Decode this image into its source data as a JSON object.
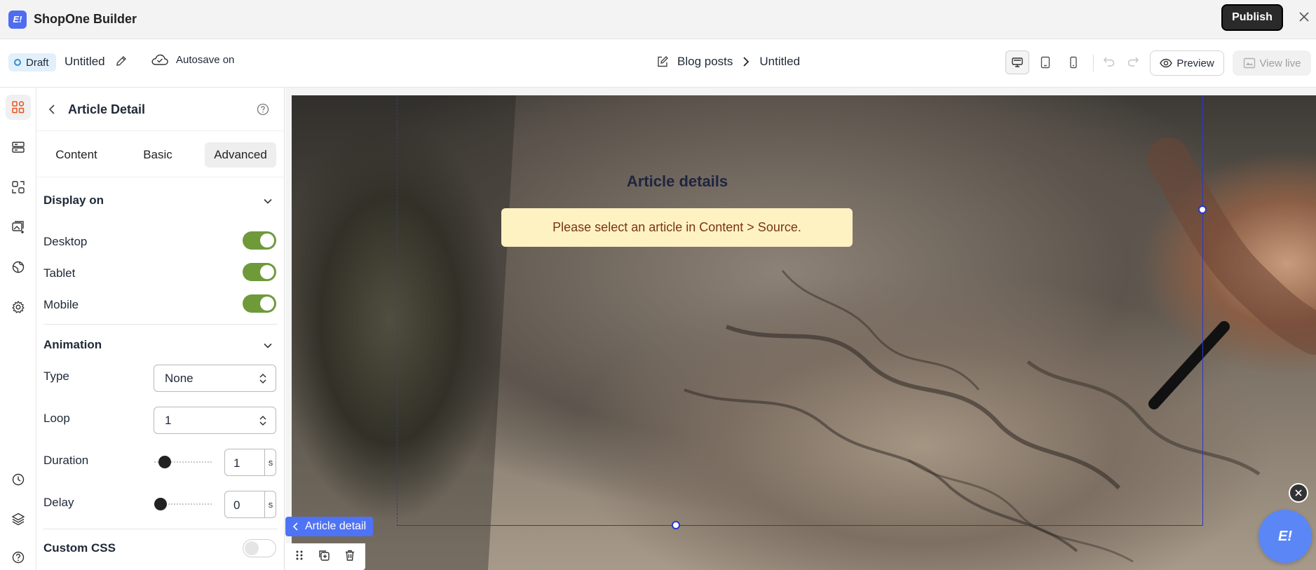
{
  "app": {
    "title": "ShopOne Builder",
    "logo_text": "E!"
  },
  "topbar": {
    "publish_label": "Publish"
  },
  "subbar": {
    "status": "Draft",
    "doc_name": "Untitled",
    "autosave": "Autosave on",
    "breadcrumb": [
      "Blog posts",
      "Untitled"
    ],
    "preview_label": "Preview",
    "view_live_label": "View live"
  },
  "panel": {
    "title": "Article Detail",
    "tabs": [
      {
        "label": "Content"
      },
      {
        "label": "Basic"
      },
      {
        "label": "Advanced"
      }
    ],
    "active_tab": "Advanced",
    "display_on": {
      "title": "Display on",
      "desktop": {
        "label": "Desktop",
        "on": true
      },
      "tablet": {
        "label": "Tablet",
        "on": true
      },
      "mobile": {
        "label": "Mobile",
        "on": true
      }
    },
    "animation": {
      "title": "Animation",
      "type_label": "Type",
      "type_value": "None",
      "loop_label": "Loop",
      "loop_value": "1",
      "duration_label": "Duration",
      "duration_value": "1",
      "duration_unit": "s",
      "delay_label": "Delay",
      "delay_value": "0",
      "delay_unit": "s"
    },
    "custom_css": {
      "label": "Custom CSS",
      "on": false
    }
  },
  "canvas": {
    "heading": "Article details",
    "notice": "Please select an article in Content > Source.",
    "element_label": "Article detail"
  },
  "colors": {
    "toggle_on": "#6e9a3a",
    "selection": "#2a37c9",
    "chip": "#4f73f5",
    "notice_bg": "#fef2c2",
    "notice_text": "#7a3414"
  }
}
